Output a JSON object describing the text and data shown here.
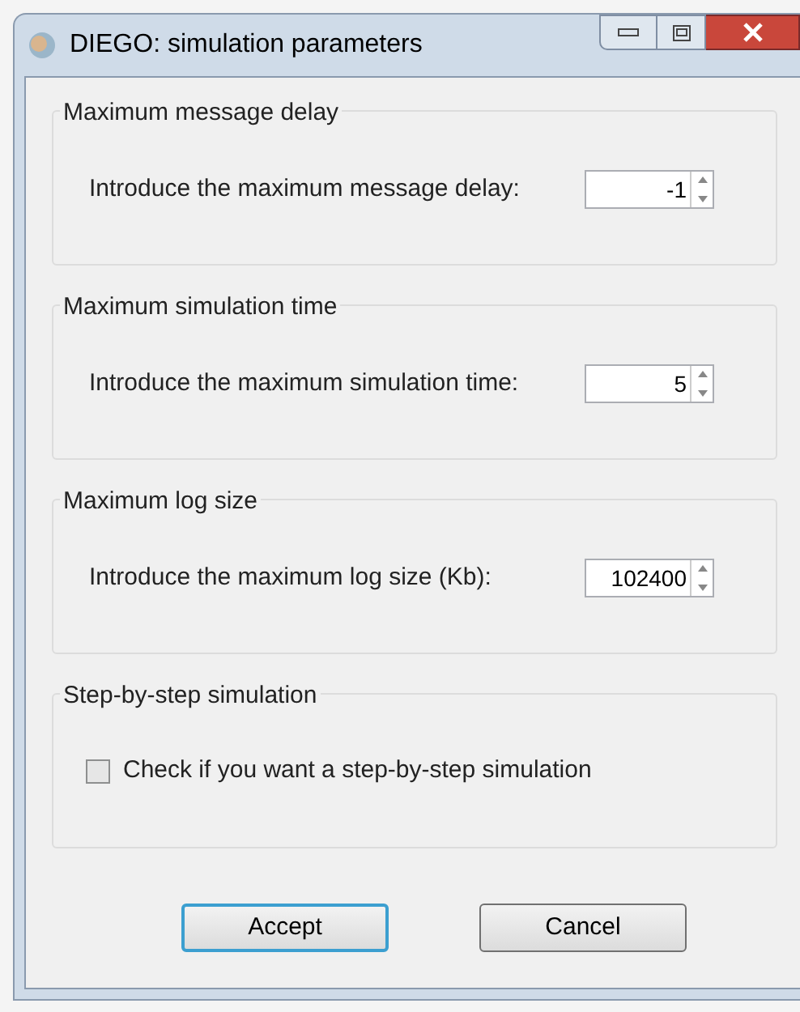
{
  "window": {
    "title": "DIEGO: simulation parameters"
  },
  "groups": [
    {
      "legend": "Maximum message delay",
      "kind": "spin",
      "label": "Introduce the maximum message delay:",
      "value": "-1"
    },
    {
      "legend": "Maximum simulation time",
      "kind": "spin",
      "label": "Introduce the maximum simulation time:",
      "value": "5"
    },
    {
      "legend": "Maximum log size",
      "kind": "spin",
      "label": "Introduce the maximum log size (Kb):",
      "value": "102400"
    },
    {
      "legend": "Step-by-step simulation",
      "kind": "checkbox",
      "label": "Check if you want a step-by-step simulation",
      "checked": false
    }
  ],
  "buttons": [
    {
      "label": "Accept",
      "default": true
    },
    {
      "label": "Cancel",
      "default": false
    }
  ]
}
